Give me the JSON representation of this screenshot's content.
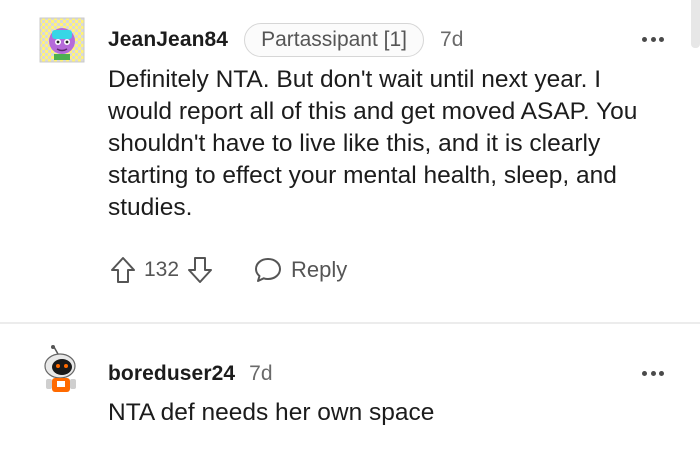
{
  "comments": [
    {
      "username": "JeanJean84",
      "flair": "Partassipant [1]",
      "age": "7d",
      "body": "Definitely NTA. But don't wait until next year. I would report all of this and get moved ASAP. You shouldn't have to live like this, and it is clearly starting to effect your mental health, sleep, and studies.",
      "votes": "132",
      "reply_label": "Reply"
    },
    {
      "username": "boreduser24",
      "age": "7d",
      "body": "NTA def needs her own space"
    }
  ],
  "icons": {
    "upvote": "upvote-arrow-icon",
    "downvote": "downvote-arrow-icon",
    "reply": "speech-bubble-icon",
    "more": "more-horizontal-icon"
  },
  "colors": {
    "text": "#1c1c1c",
    "muted": "#555555",
    "divider": "#ececec",
    "flair_border": "#d6d6d6"
  }
}
